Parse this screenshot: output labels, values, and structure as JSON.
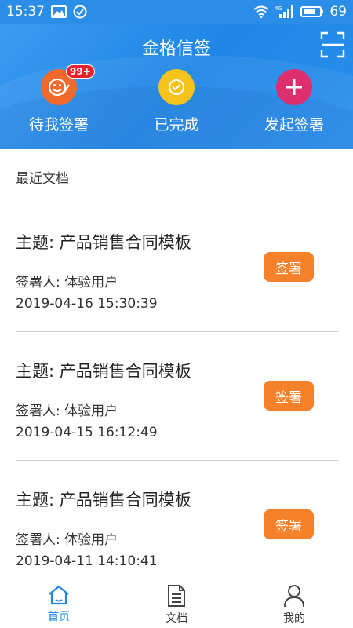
{
  "status_bar": {
    "time": "15:37",
    "battery": "69",
    "network": "4G",
    "icons_left": [
      "image-icon",
      "check-circle-icon"
    ],
    "icons_right": [
      "wifi-icon",
      "signal-icon",
      "battery-icon"
    ]
  },
  "header": {
    "title": "金格信签",
    "scan_icon": "scan-icon",
    "actions": [
      {
        "label": "待我签署",
        "badge": "99+",
        "icon": "sign-pen-icon",
        "color": "#f26a2b"
      },
      {
        "label": "已完成",
        "icon": "check-icon",
        "color": "#f6c21c"
      },
      {
        "label": "发起签署",
        "icon": "plus-icon",
        "color": "#dd2e6e"
      }
    ]
  },
  "recent": {
    "title": "最近文档",
    "items": [
      {
        "subject": "主题:  产品销售合同模板",
        "signer": "签署人:  体验用户",
        "date": "2019-04-16 15:30:39",
        "button": "签署"
      },
      {
        "subject": "主题:  产品销售合同模板",
        "signer": "签署人:  体验用户",
        "date": "2019-04-15 16:12:49",
        "button": "签署"
      },
      {
        "subject": "主题:  产品销售合同模板",
        "signer": "签署人:  体验用户",
        "date": "2019-04-11 14:10:41",
        "button": "签署"
      }
    ]
  },
  "bottom_nav": {
    "items": [
      {
        "label": "首页",
        "icon": "home-icon",
        "active": true
      },
      {
        "label": "文档",
        "icon": "document-icon",
        "active": false
      },
      {
        "label": "我的",
        "icon": "user-icon",
        "active": false
      }
    ],
    "active_color": "#1e88e5"
  },
  "colors": {
    "header": "#2a8de8",
    "sign_button": "#f5822a",
    "badge": "#e8232c"
  }
}
